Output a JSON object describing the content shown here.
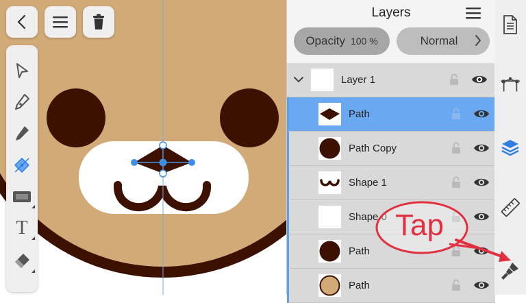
{
  "panel": {
    "title": "Layers",
    "opacity_label": "Opacity",
    "opacity_value": "100 %",
    "blend_mode": "Normal"
  },
  "layers": [
    {
      "name": "Layer 1",
      "thumb": "blank",
      "selected": false,
      "group": true
    },
    {
      "name": "Path",
      "thumb": "nose-diamond",
      "selected": true
    },
    {
      "name": "Path Copy",
      "thumb": "dark-circle",
      "selected": false
    },
    {
      "name": "Shape 1",
      "thumb": "mouth",
      "selected": false
    },
    {
      "name": "Shape 0",
      "thumb": "blank",
      "selected": false
    },
    {
      "name": "Path",
      "thumb": "dark-circle",
      "selected": false
    },
    {
      "name": "Path",
      "thumb": "tan-circle",
      "selected": false
    }
  ],
  "tools": [
    "selection-arrow-icon",
    "pen-icon",
    "pencil-icon",
    "node-edit-icon",
    "shape-icon",
    "text-tool-icon",
    "eraser-icon"
  ],
  "text_tool_glyph": "T",
  "sidebar_icons": [
    "document-icon",
    "vector-path-icon",
    "layers-icon",
    "ruler-icon",
    "brush-icon"
  ],
  "annotation": {
    "text": "Tap"
  },
  "colors": {
    "accent": "#5fa0e6",
    "selected_row": "#6aa9f1",
    "face": "#d2aa78",
    "dark_brown": "#3c1100",
    "annotation": "#e1303f",
    "layers_active": "#2f7fe0"
  }
}
